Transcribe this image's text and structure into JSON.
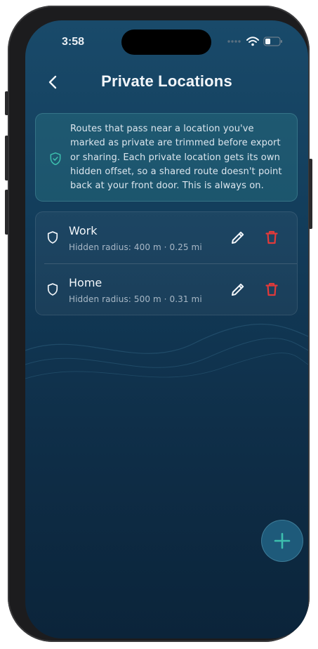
{
  "status_bar": {
    "time": "3:58"
  },
  "header": {
    "title": "Private Locations"
  },
  "info": {
    "text": "Routes that pass near a location you've marked as private are trimmed before export or sharing. Each private location gets its own hidden offset, so a shared route doesn't point back at your front door. This is always on."
  },
  "locations": [
    {
      "name": "Work",
      "detail": "Hidden radius: 400 m · 0.25 mi"
    },
    {
      "name": "Home",
      "detail": "Hidden radius: 500 m · 0.31 mi"
    }
  ],
  "icons": {
    "back": "chevron-left-icon",
    "info": "shield-check-icon",
    "location": "shield-icon",
    "edit": "pencil-icon",
    "delete": "trash-icon",
    "add": "plus-icon"
  },
  "colors": {
    "accent": "#3dbfae",
    "delete": "#e23a3a",
    "background_top": "#194a6a",
    "background_bottom": "#0b243a"
  }
}
